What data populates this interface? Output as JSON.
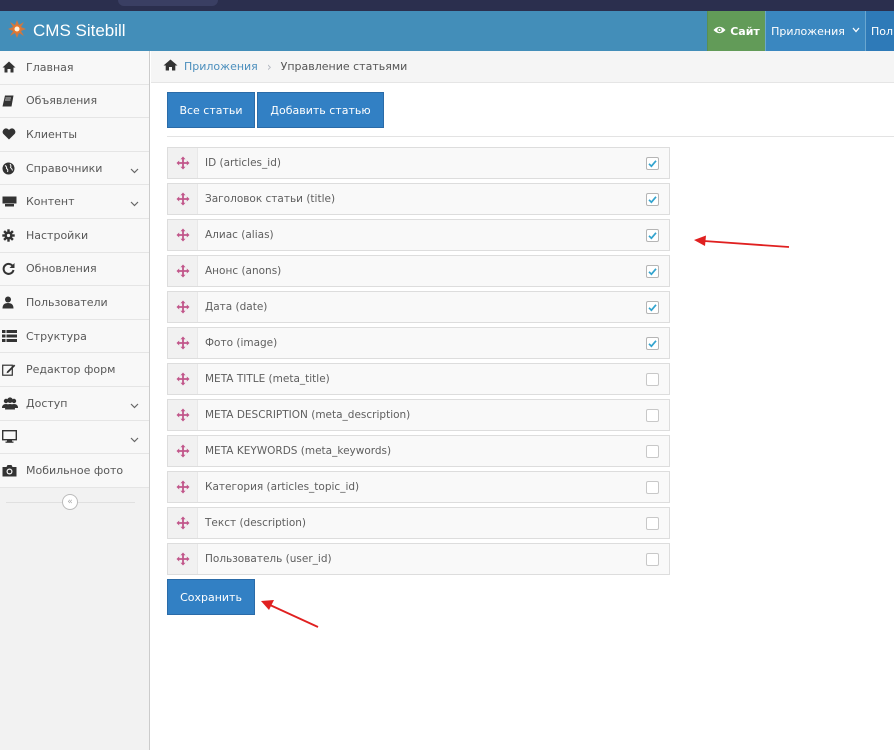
{
  "brand": {
    "title": "CMS Sitebill"
  },
  "navbar": {
    "site_label": "Сайт",
    "apps_label": "Приложения",
    "user_label": "Пол"
  },
  "sidebar": {
    "items": [
      {
        "label": "Главная",
        "icon": "home-icon",
        "has_submenu": false
      },
      {
        "label": "Объявления",
        "icon": "book-icon",
        "has_submenu": false
      },
      {
        "label": "Клиенты",
        "icon": "heart-icon",
        "has_submenu": false
      },
      {
        "label": "Справочники",
        "icon": "globe-icon",
        "has_submenu": true
      },
      {
        "label": "Контент",
        "icon": "keyboard-icon",
        "has_submenu": true
      },
      {
        "label": "Настройки",
        "icon": "gear-icon",
        "has_submenu": false
      },
      {
        "label": "Обновления",
        "icon": "refresh-icon",
        "has_submenu": false
      },
      {
        "label": "Пользователи",
        "icon": "user-icon",
        "has_submenu": false
      },
      {
        "label": "Структура",
        "icon": "list-icon",
        "has_submenu": false
      },
      {
        "label": "Редактор форм",
        "icon": "edit-icon",
        "has_submenu": false
      },
      {
        "label": "Доступ",
        "icon": "users-icon",
        "has_submenu": true
      },
      {
        "label": "",
        "icon": "desktop-icon",
        "has_submenu": true
      },
      {
        "label": "Мобильное фото",
        "icon": "camera-icon",
        "has_submenu": false
      }
    ],
    "collapse_glyph": "«"
  },
  "breadcrumb": {
    "root": "Приложения",
    "current": "Управление статьями"
  },
  "tabs": {
    "all_articles": "Все статьи",
    "add_article": "Добавить статью"
  },
  "fields": [
    {
      "label": "ID (articles_id)",
      "checked": true
    },
    {
      "label": "Заголовок статьи (title)",
      "checked": true
    },
    {
      "label": "Алиас (alias)",
      "checked": true
    },
    {
      "label": "Анонс (anons)",
      "checked": true
    },
    {
      "label": "Дата (date)",
      "checked": true
    },
    {
      "label": "Фото (image)",
      "checked": true
    },
    {
      "label": "META TITLE (meta_title)",
      "checked": false
    },
    {
      "label": "META DESCRIPTION (meta_description)",
      "checked": false
    },
    {
      "label": "META KEYWORDS (meta_keywords)",
      "checked": false
    },
    {
      "label": "Категория (articles_topic_id)",
      "checked": false
    },
    {
      "label": "Текст (description)",
      "checked": false
    },
    {
      "label": "Пользователь (user_id)",
      "checked": false
    }
  ],
  "save_label": "Сохранить",
  "colors": {
    "navbar": "#438eb9",
    "site_button": "#629b58",
    "primary_button": "#3280c4",
    "drag_handle": "#c1568a",
    "annotation_arrow": "#e02020"
  }
}
